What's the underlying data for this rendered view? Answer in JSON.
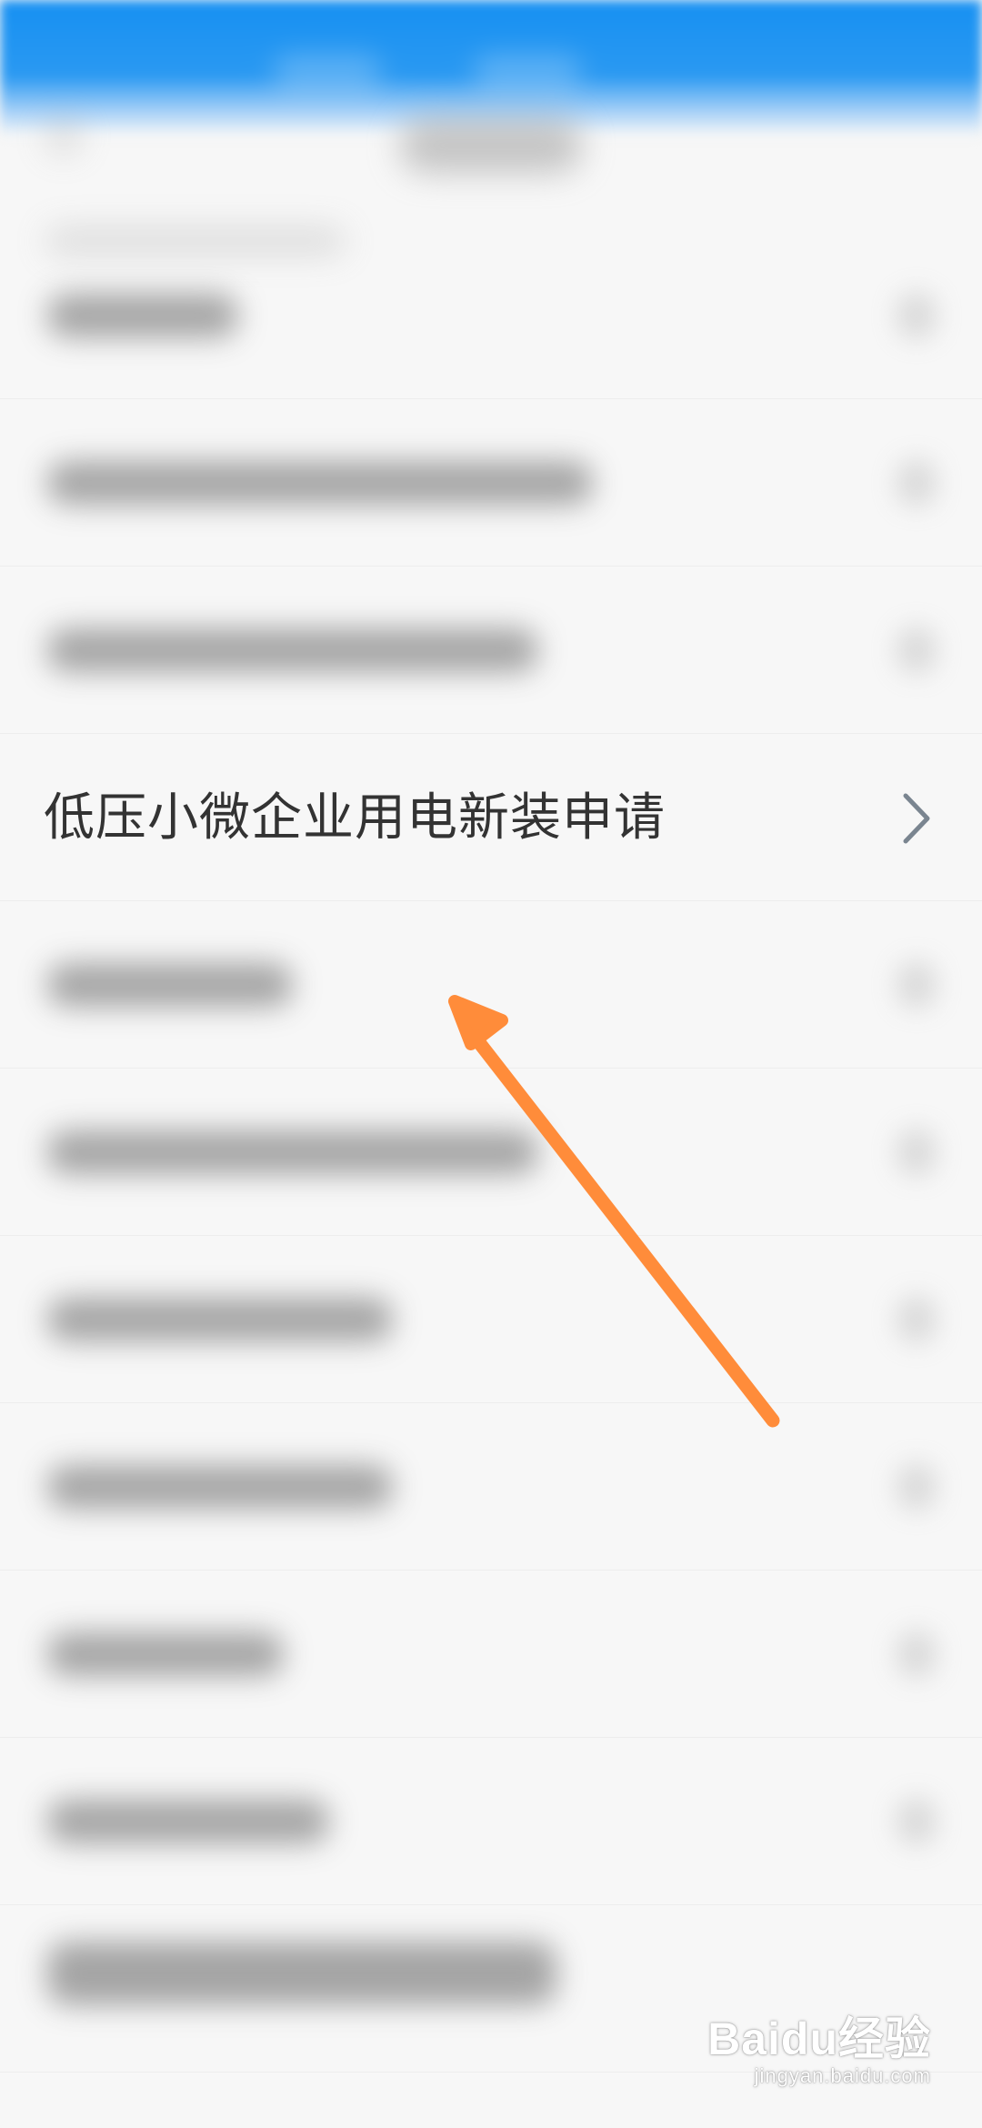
{
  "list": {
    "highlighted_item": {
      "label": "低压小微企业用电新装申请"
    }
  },
  "annotation": {
    "arrow_color": "#ff8c3a"
  },
  "watermark": {
    "brand": "Baidu经验",
    "site": "jingyan.baidu.com"
  },
  "colors": {
    "header_blue": "#1690f2",
    "background": "#f7f7f7",
    "text": "#333333",
    "chevron": "#7a8590"
  }
}
